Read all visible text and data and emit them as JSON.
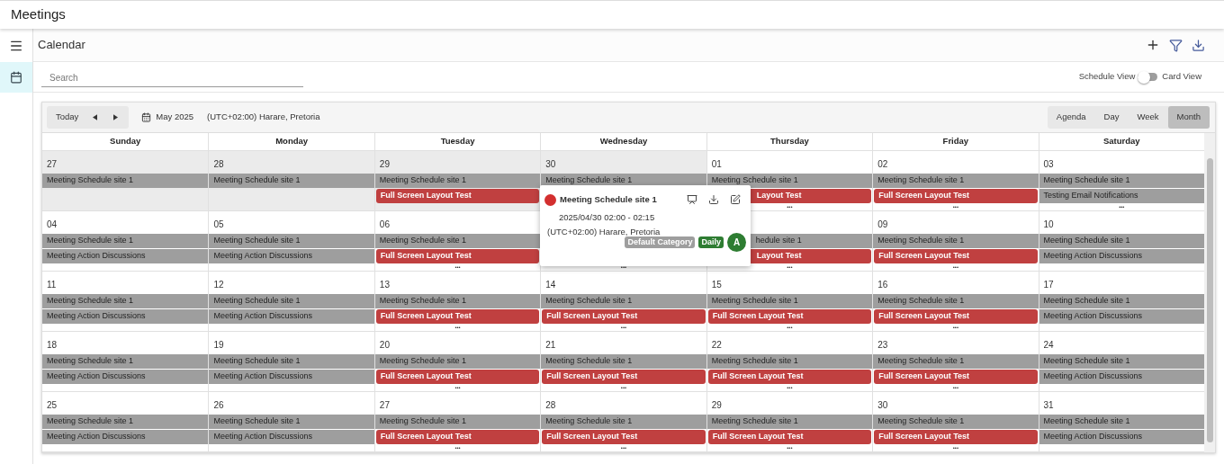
{
  "app_title": "Meetings",
  "header": {
    "title": "Calendar"
  },
  "sidebar": {
    "items": [
      {
        "selected": true
      }
    ]
  },
  "search": {
    "placeholder": "Search"
  },
  "view_toggle": {
    "left_label": "Schedule View",
    "right_label": "Card View",
    "on": false
  },
  "calendar": {
    "today": "Today",
    "month_label": "May 2025",
    "timezone": "(UTC+02:00) Harare, Pretoria",
    "views": [
      {
        "label": "Agenda",
        "selected": false
      },
      {
        "label": "Day",
        "selected": false
      },
      {
        "label": "Week",
        "selected": false
      },
      {
        "label": "Month",
        "selected": true
      }
    ],
    "weekdays": [
      "Sunday",
      "Monday",
      "Tuesday",
      "Wednesday",
      "Thursday",
      "Friday",
      "Saturday"
    ],
    "weeks": [
      {
        "days": [
          {
            "date": "27",
            "other_month": true,
            "events": [
              {
                "title": "Meeting Schedule site 1",
                "kind": "normal"
              }
            ]
          },
          {
            "date": "28",
            "other_month": true,
            "events": [
              {
                "title": "Meeting Schedule site 1",
                "kind": "normal"
              }
            ]
          },
          {
            "date": "29",
            "other_month": true,
            "events": [
              {
                "title": "Meeting Schedule site 1",
                "kind": "normal"
              },
              {
                "title": "Full Screen Layout Test",
                "kind": "highlighted"
              }
            ]
          },
          {
            "date": "30",
            "other_month": true,
            "events": [
              {
                "title": "Meeting Schedule site 1",
                "kind": "normal"
              }
            ]
          },
          {
            "date": "01",
            "other_month": false,
            "events": [
              {
                "title": "Meeting Schedule site 1",
                "kind": "normal"
              },
              {
                "title": "Layout Test",
                "kind": "highlighted",
                "covered": true
              }
            ],
            "more": "•••"
          },
          {
            "date": "02",
            "other_month": false,
            "events": [
              {
                "title": "Meeting Schedule site 1",
                "kind": "normal"
              },
              {
                "title": "Full Screen Layout Test",
                "kind": "highlighted"
              }
            ],
            "more": "•••"
          },
          {
            "date": "03",
            "other_month": false,
            "events": [
              {
                "title": "Meeting Schedule site 1",
                "kind": "normal"
              },
              {
                "title": "Testing Email Notifications",
                "kind": "normal"
              }
            ],
            "more": "•••"
          }
        ]
      },
      {
        "days": [
          {
            "date": "04",
            "other_month": false,
            "events": [
              {
                "title": "Meeting Schedule site 1",
                "kind": "normal"
              },
              {
                "title": "Meeting Action Discussions",
                "kind": "normal"
              }
            ]
          },
          {
            "date": "05",
            "other_month": false,
            "events": [
              {
                "title": "Meeting Schedule site 1",
                "kind": "normal"
              },
              {
                "title": "Meeting Action Discussions",
                "kind": "normal"
              }
            ]
          },
          {
            "date": "06",
            "other_month": false,
            "events": [
              {
                "title": "Meeting Schedule site 1",
                "kind": "normal"
              },
              {
                "title": "Full Screen Layout Test",
                "kind": "highlighted"
              }
            ],
            "more": "•••"
          },
          {
            "other_month": false,
            "more": "•••"
          },
          {
            "other_month": false,
            "events": [
              {
                "title": "hedule site 1",
                "kind": "normal",
                "covered": true
              },
              {
                "title": "Layout Test",
                "kind": "highlighted",
                "covered": true
              }
            ],
            "more": "•••"
          },
          {
            "date": "09",
            "other_month": false,
            "events": [
              {
                "title": "Meeting Schedule site 1",
                "kind": "normal"
              },
              {
                "title": "Full Screen Layout Test",
                "kind": "highlighted"
              }
            ],
            "more": "•••"
          },
          {
            "date": "10",
            "other_month": false,
            "events": [
              {
                "title": "Meeting Schedule site 1",
                "kind": "normal"
              },
              {
                "title": "Meeting Action Discussions",
                "kind": "normal"
              }
            ]
          }
        ]
      },
      {
        "days": [
          {
            "date": "11",
            "other_month": false,
            "events": [
              {
                "title": "Meeting Schedule site 1",
                "kind": "normal"
              },
              {
                "title": "Meeting Action Discussions",
                "kind": "normal"
              }
            ]
          },
          {
            "date": "12",
            "other_month": false,
            "events": [
              {
                "title": "Meeting Schedule site 1",
                "kind": "normal"
              },
              {
                "title": "Meeting Action Discussions",
                "kind": "normal"
              }
            ]
          },
          {
            "date": "13",
            "other_month": false,
            "events": [
              {
                "title": "Meeting Schedule site 1",
                "kind": "normal"
              },
              {
                "title": "Full Screen Layout Test",
                "kind": "highlighted"
              }
            ],
            "more": "•••"
          },
          {
            "date": "14",
            "other_month": false,
            "events": [
              {
                "title": "Meeting Schedule site 1",
                "kind": "normal"
              },
              {
                "title": "Full Screen Layout Test",
                "kind": "highlighted"
              }
            ],
            "more": "•••"
          },
          {
            "date": "15",
            "other_month": false,
            "events": [
              {
                "title": "Meeting Schedule site 1",
                "kind": "normal"
              },
              {
                "title": "Full Screen Layout Test",
                "kind": "highlighted"
              }
            ],
            "more": "•••"
          },
          {
            "date": "16",
            "other_month": false,
            "events": [
              {
                "title": "Meeting Schedule site 1",
                "kind": "normal"
              },
              {
                "title": "Full Screen Layout Test",
                "kind": "highlighted"
              }
            ],
            "more": "•••"
          },
          {
            "date": "17",
            "other_month": false,
            "events": [
              {
                "title": "Meeting Schedule site 1",
                "kind": "normal"
              },
              {
                "title": "Meeting Action Discussions",
                "kind": "normal"
              }
            ]
          }
        ]
      },
      {
        "days": [
          {
            "date": "18",
            "other_month": false,
            "events": [
              {
                "title": "Meeting Schedule site 1",
                "kind": "normal"
              },
              {
                "title": "Meeting Action Discussions",
                "kind": "normal"
              }
            ]
          },
          {
            "date": "19",
            "other_month": false,
            "events": [
              {
                "title": "Meeting Schedule site 1",
                "kind": "normal"
              },
              {
                "title": "Meeting Action Discussions",
                "kind": "normal"
              }
            ]
          },
          {
            "date": "20",
            "other_month": false,
            "events": [
              {
                "title": "Meeting Schedule site 1",
                "kind": "normal"
              },
              {
                "title": "Full Screen Layout Test",
                "kind": "highlighted"
              }
            ],
            "more": "•••"
          },
          {
            "date": "21",
            "other_month": false,
            "events": [
              {
                "title": "Meeting Schedule site 1",
                "kind": "normal"
              },
              {
                "title": "Full Screen Layout Test",
                "kind": "highlighted"
              }
            ],
            "more": "•••"
          },
          {
            "date": "22",
            "other_month": false,
            "events": [
              {
                "title": "Meeting Schedule site 1",
                "kind": "normal"
              },
              {
                "title": "Full Screen Layout Test",
                "kind": "highlighted"
              }
            ],
            "more": "•••"
          },
          {
            "date": "23",
            "other_month": false,
            "events": [
              {
                "title": "Meeting Schedule site 1",
                "kind": "normal"
              },
              {
                "title": "Full Screen Layout Test",
                "kind": "highlighted"
              }
            ],
            "more": "•••"
          },
          {
            "date": "24",
            "other_month": false,
            "events": [
              {
                "title": "Meeting Schedule site 1",
                "kind": "normal"
              },
              {
                "title": "Meeting Action Discussions",
                "kind": "normal"
              }
            ]
          }
        ]
      },
      {
        "days": [
          {
            "date": "25",
            "other_month": false,
            "events": [
              {
                "title": "Meeting Schedule site 1",
                "kind": "normal"
              },
              {
                "title": "Meeting Action Discussions",
                "kind": "normal"
              }
            ]
          },
          {
            "date": "26",
            "other_month": false,
            "events": [
              {
                "title": "Meeting Schedule site 1",
                "kind": "normal"
              },
              {
                "title": "Meeting Action Discussions",
                "kind": "normal"
              }
            ]
          },
          {
            "date": "27",
            "other_month": false,
            "events": [
              {
                "title": "Meeting Schedule site 1",
                "kind": "normal"
              },
              {
                "title": "Full Screen Layout Test",
                "kind": "highlighted"
              }
            ],
            "more": "•••"
          },
          {
            "date": "28",
            "other_month": false,
            "events": [
              {
                "title": "Meeting Schedule site 1",
                "kind": "normal"
              },
              {
                "title": "Full Screen Layout Test",
                "kind": "highlighted"
              }
            ],
            "more": "•••"
          },
          {
            "date": "29",
            "other_month": false,
            "events": [
              {
                "title": "Meeting Schedule site 1",
                "kind": "normal"
              },
              {
                "title": "Full Screen Layout Test",
                "kind": "highlighted"
              }
            ],
            "more": "•••"
          },
          {
            "date": "30",
            "other_month": false,
            "events": [
              {
                "title": "Meeting Schedule site 1",
                "kind": "normal"
              },
              {
                "title": "Full Screen Layout Test",
                "kind": "highlighted"
              }
            ],
            "more": "•••"
          },
          {
            "date": "31",
            "other_month": false,
            "events": [
              {
                "title": "Meeting Schedule site 1",
                "kind": "normal"
              },
              {
                "title": "Meeting Action Discussions",
                "kind": "normal"
              }
            ]
          }
        ]
      }
    ]
  },
  "popup": {
    "title": "Meeting Schedule site 1",
    "color": "#d32f2f",
    "time": "2025/04/30 02:00 - 02:15",
    "timezone": "(UTC+02:00) Harare, Pretoria",
    "tags": [
      {
        "label": "Default Category",
        "color": "#9e9e9e"
      },
      {
        "label": "Daily",
        "color": "#2e7d32"
      }
    ],
    "avatar": "A"
  }
}
